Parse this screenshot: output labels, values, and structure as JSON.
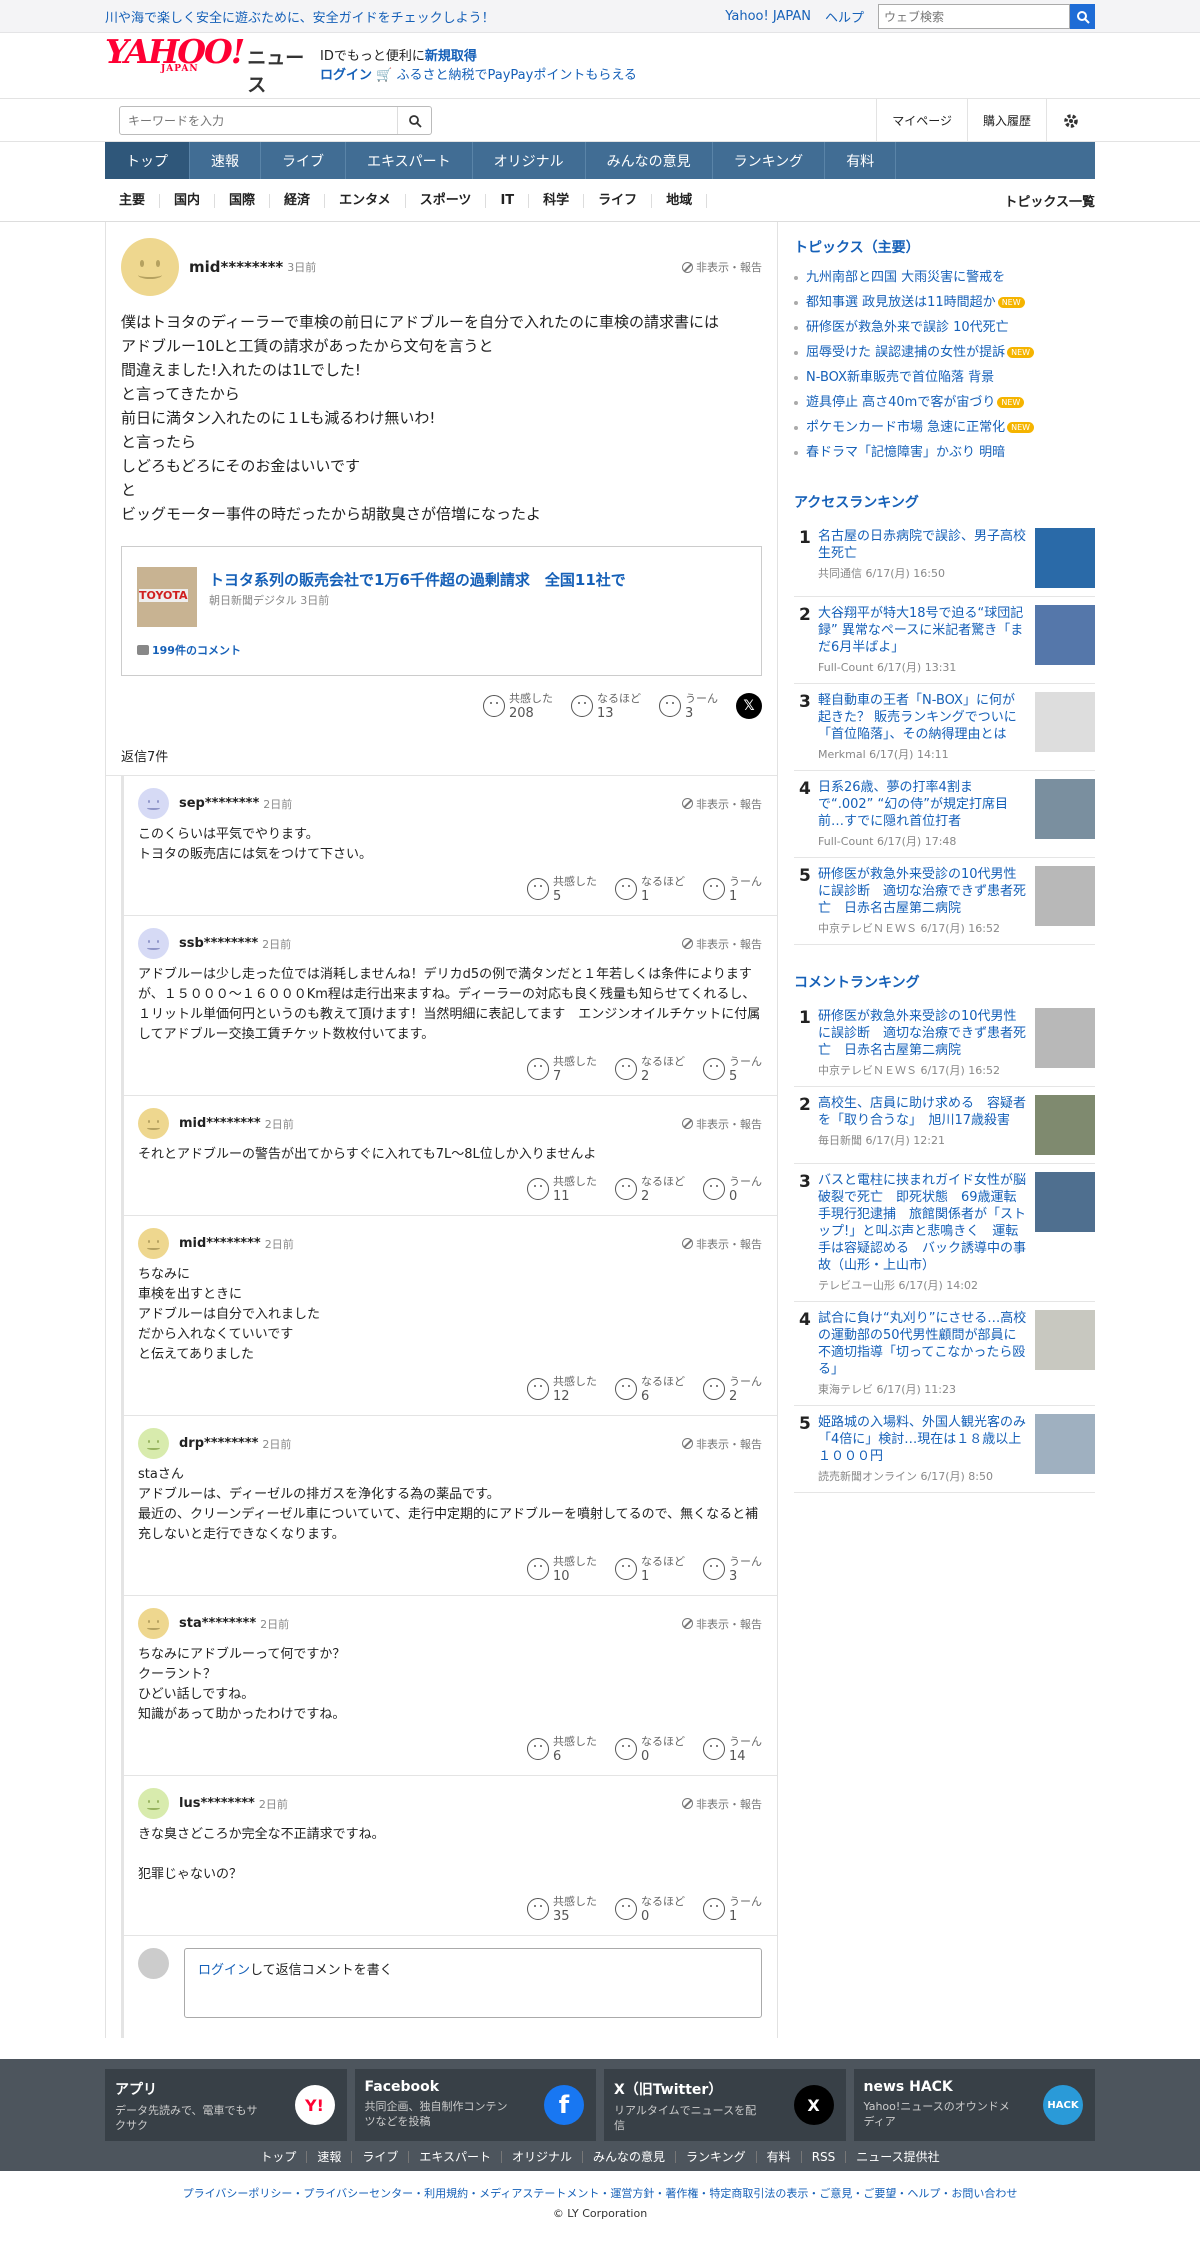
{
  "topbar": {
    "promo": "川や海で楽しく安全に遊ぶために、安全ガイドをチェックしよう！",
    "yahoo": "Yahoo! JAPAN",
    "help": "ヘルプ",
    "search_placeholder": "ウェブ検索"
  },
  "header": {
    "logo": "YAHOO!",
    "logo_sub": "JAPAN",
    "logo_news": "ニュース",
    "id_text": "IDでもっと便利に",
    "signup": "新規取得",
    "login": "ログイン",
    "furusato": "ふるさと納税でPayPayポイントもらえる"
  },
  "subbar": {
    "kw_placeholder": "キーワードを入力",
    "mypage": "マイページ",
    "history": "購入履歴"
  },
  "mainnav": [
    "トップ",
    "速報",
    "ライブ",
    "エキスパート",
    "オリジナル",
    "みんなの意見",
    "ランキング",
    "有料"
  ],
  "topicnav": {
    "items": [
      "主要",
      "国内",
      "国際",
      "経済",
      "エンタメ",
      "スポーツ",
      "IT",
      "科学",
      "ライフ",
      "地域"
    ],
    "all": "トピックス一覧"
  },
  "main": {
    "user": "mid********",
    "time": "3日前",
    "report": "非表示・報告",
    "body": "僕はトヨタのディーラーで車検の前日にアドブルーを自分で入れたのに車検の請求書には\nアドブルー10Lと工賃の請求があったから文句を言うと\n間違えました!入れたのは1Lでした!\nと言ってきたから\n前日に満タン入れたのに１Lも減るわけ無いわ!\nと言ったら\nしどろもどろにそのお金はいいです\nと\nビッグモーター事件の時だったから胡散臭さが倍増になったよ",
    "article": {
      "title": "トヨタ系列の販売会社で1万6千件超の過剰請求　全国11社で",
      "source": "朝日新聞デジタル 3日前",
      "comments": "199件のコメント"
    },
    "reactions": {
      "k": "共感した",
      "n": "なるほど",
      "u": "うーん",
      "kv": "208",
      "nv": "13",
      "uv": "3"
    },
    "replies_header": "返信7件"
  },
  "replies": [
    {
      "user": "sep********",
      "time": "2日前",
      "body": "このくらいは平気でやります。\nトヨタの販売店には気をつけて下さい。",
      "k": "5",
      "n": "1",
      "u": "1"
    },
    {
      "user": "ssb********",
      "time": "2日前",
      "body": "アドブルーは少し走った位では消耗しませんね！デリカd5の例で満タンだと１年若しくは条件によりますが、１５０００〜１６０００Km程は走行出来ますね。ディーラーの対応も良く残量も知らせてくれるし、１リットル単価何円というのも教えて頂けます！当然明細に表記してます　エンジンオイルチケットに付属してアドブルー交換工賃チケット数枚付いてます。",
      "k": "7",
      "n": "2",
      "u": "5"
    },
    {
      "user": "mid********",
      "time": "2日前",
      "body": "それとアドブルーの警告が出てからすぐに入れても7L〜8L位しか入りませんよ",
      "k": "11",
      "n": "2",
      "u": "0"
    },
    {
      "user": "mid********",
      "time": "2日前",
      "body": "ちなみに\n車検を出すときに\nアドブルーは自分で入れました\nだから入れなくていいです\nと伝えてありました",
      "k": "12",
      "n": "6",
      "u": "2"
    },
    {
      "user": "drp********",
      "time": "2日前",
      "body": "staさん\nアドブルーは、ディーゼルの排ガスを浄化する為の薬品です。\n最近の、クリーンディーゼル車についていて、走行中定期的にアドブルーを噴射してるので、無くなると補充しないと走行できなくなります。",
      "k": "10",
      "n": "1",
      "u": "3"
    },
    {
      "user": "sta********",
      "time": "2日前",
      "body": "ちなみにアドブルーって何ですか？\nクーラント？\nひどい話しですね。\n知識があって助かったわけですね。",
      "k": "6",
      "n": "0",
      "u": "14"
    },
    {
      "user": "lus********",
      "time": "2日前",
      "body": "きな臭さどころか完全な不正請求ですね。\n\n犯罪じゃないの？",
      "k": "35",
      "n": "0",
      "u": "1"
    }
  ],
  "replybox": {
    "login": "ログイン",
    "text": "して返信コメントを書く"
  },
  "sidebar": {
    "topics_h": "トピックス（主要）",
    "topics": [
      {
        "t": "九州南部と四国 大雨災害に警戒を",
        "new": ""
      },
      {
        "t": "都知事選 政見放送は11時間超か",
        "new": "NEW"
      },
      {
        "t": "研修医が救急外来で誤診 10代死亡",
        "new": ""
      },
      {
        "t": "屈辱受けた 誤認逮捕の女性が提訴",
        "new": "NEW"
      },
      {
        "t": "N-BOX新車販売で首位陥落 背景",
        "new": ""
      },
      {
        "t": "遊具停止 高さ40mで客が宙づり",
        "new": "NEW"
      },
      {
        "t": "ポケモンカード市場 急速に正常化",
        "new": "NEW"
      },
      {
        "t": "春ドラマ「記憶障害」かぶり 明暗",
        "new": ""
      }
    ],
    "access_h": "アクセスランキング",
    "access": [
      {
        "no": "1",
        "t": "名古屋の日赤病院で誤診、男子高校生死亡",
        "m": "共同通信 6/17(月) 16:50"
      },
      {
        "no": "2",
        "t": "大谷翔平が特大18号で迫る“球団記録” 異常なペースに米記者驚き「まだ6月半ばよ」",
        "m": "Full-Count 6/17(月) 13:31"
      },
      {
        "no": "3",
        "t": "軽自動車の王者「N-BOX」に何が起きた？ 販売ランキングでついに「首位陥落」、その納得理由とは",
        "m": "Merkmal 6/17(月) 14:11"
      },
      {
        "no": "4",
        "t": "日系26歳、夢の打率4割まで“.002” “幻の侍”が規定打席目前…すでに隠れ首位打者",
        "m": "Full-Count 6/17(月) 17:48"
      },
      {
        "no": "5",
        "t": "研修医が救急外来受診の10代男性に誤診断　適切な治療できず患者死亡　日赤名古屋第二病院",
        "m": "中京テレビＮＥＷＳ 6/17(月) 16:52"
      }
    ],
    "comment_h": "コメントランキング",
    "comment": [
      {
        "no": "1",
        "t": "研修医が救急外来受診の10代男性に誤診断　適切な治療できず患者死亡　日赤名古屋第二病院",
        "m": "中京テレビＮＥＷＳ 6/17(月) 16:52"
      },
      {
        "no": "2",
        "t": "高校生、店員に助け求める　容疑者を「取り合うな」　旭川17歳殺害",
        "m": "毎日新聞 6/17(月) 12:21"
      },
      {
        "no": "3",
        "t": "バスと電柱に挟まれガイド女性が脳破裂で死亡　即死状態　69歳運転手現行犯逮捕　旅館関係者が「ストップ!」と叫ぶ声と悲鳴きく　運転手は容疑認める　バック誘導中の事故（山形・上山市）",
        "m": "テレビユー山形 6/17(月) 14:02"
      },
      {
        "no": "4",
        "t": "試合に負け“丸刈り”にさせる…高校の運動部の50代男性顧問が部員に不適切指導「切ってこなかったら殴る」",
        "m": "東海テレビ 6/17(月) 11:23"
      },
      {
        "no": "5",
        "t": "姫路城の入場料、外国人観光客のみ「4倍に」検討…現在は１８歳以上１０００円",
        "m": "読売新聞オンライン 6/17(月) 8:50"
      }
    ]
  },
  "footer": {
    "boxes": [
      {
        "t": "アプリ",
        "d": "データ先読みで、電車でもサクサク",
        "icon": "Y!"
      },
      {
        "t": "Facebook",
        "d": "共同企画、独自制作コンテンツなどを投稿",
        "icon": "f"
      },
      {
        "t": "X（旧Twitter）",
        "d": "リアルタイムでニュースを配信",
        "icon": "X"
      },
      {
        "t": "news HACK",
        "d": "Yahoo!ニュースのオウンドメディア",
        "icon": "HACK"
      }
    ],
    "nav": [
      "トップ",
      "速報",
      "ライブ",
      "エキスパート",
      "オリジナル",
      "みんなの意見",
      "ランキング",
      "有料",
      "RSS",
      "ニュース提供社"
    ],
    "legal": "プライバシーポリシー・プライバシーセンター・利用規約・メディアステートメント・運営方針・著作権・特定商取引法の表示・ご意見・ご要望・ヘルプ・お問い合わせ",
    "copy": "© LY Corporation"
  }
}
